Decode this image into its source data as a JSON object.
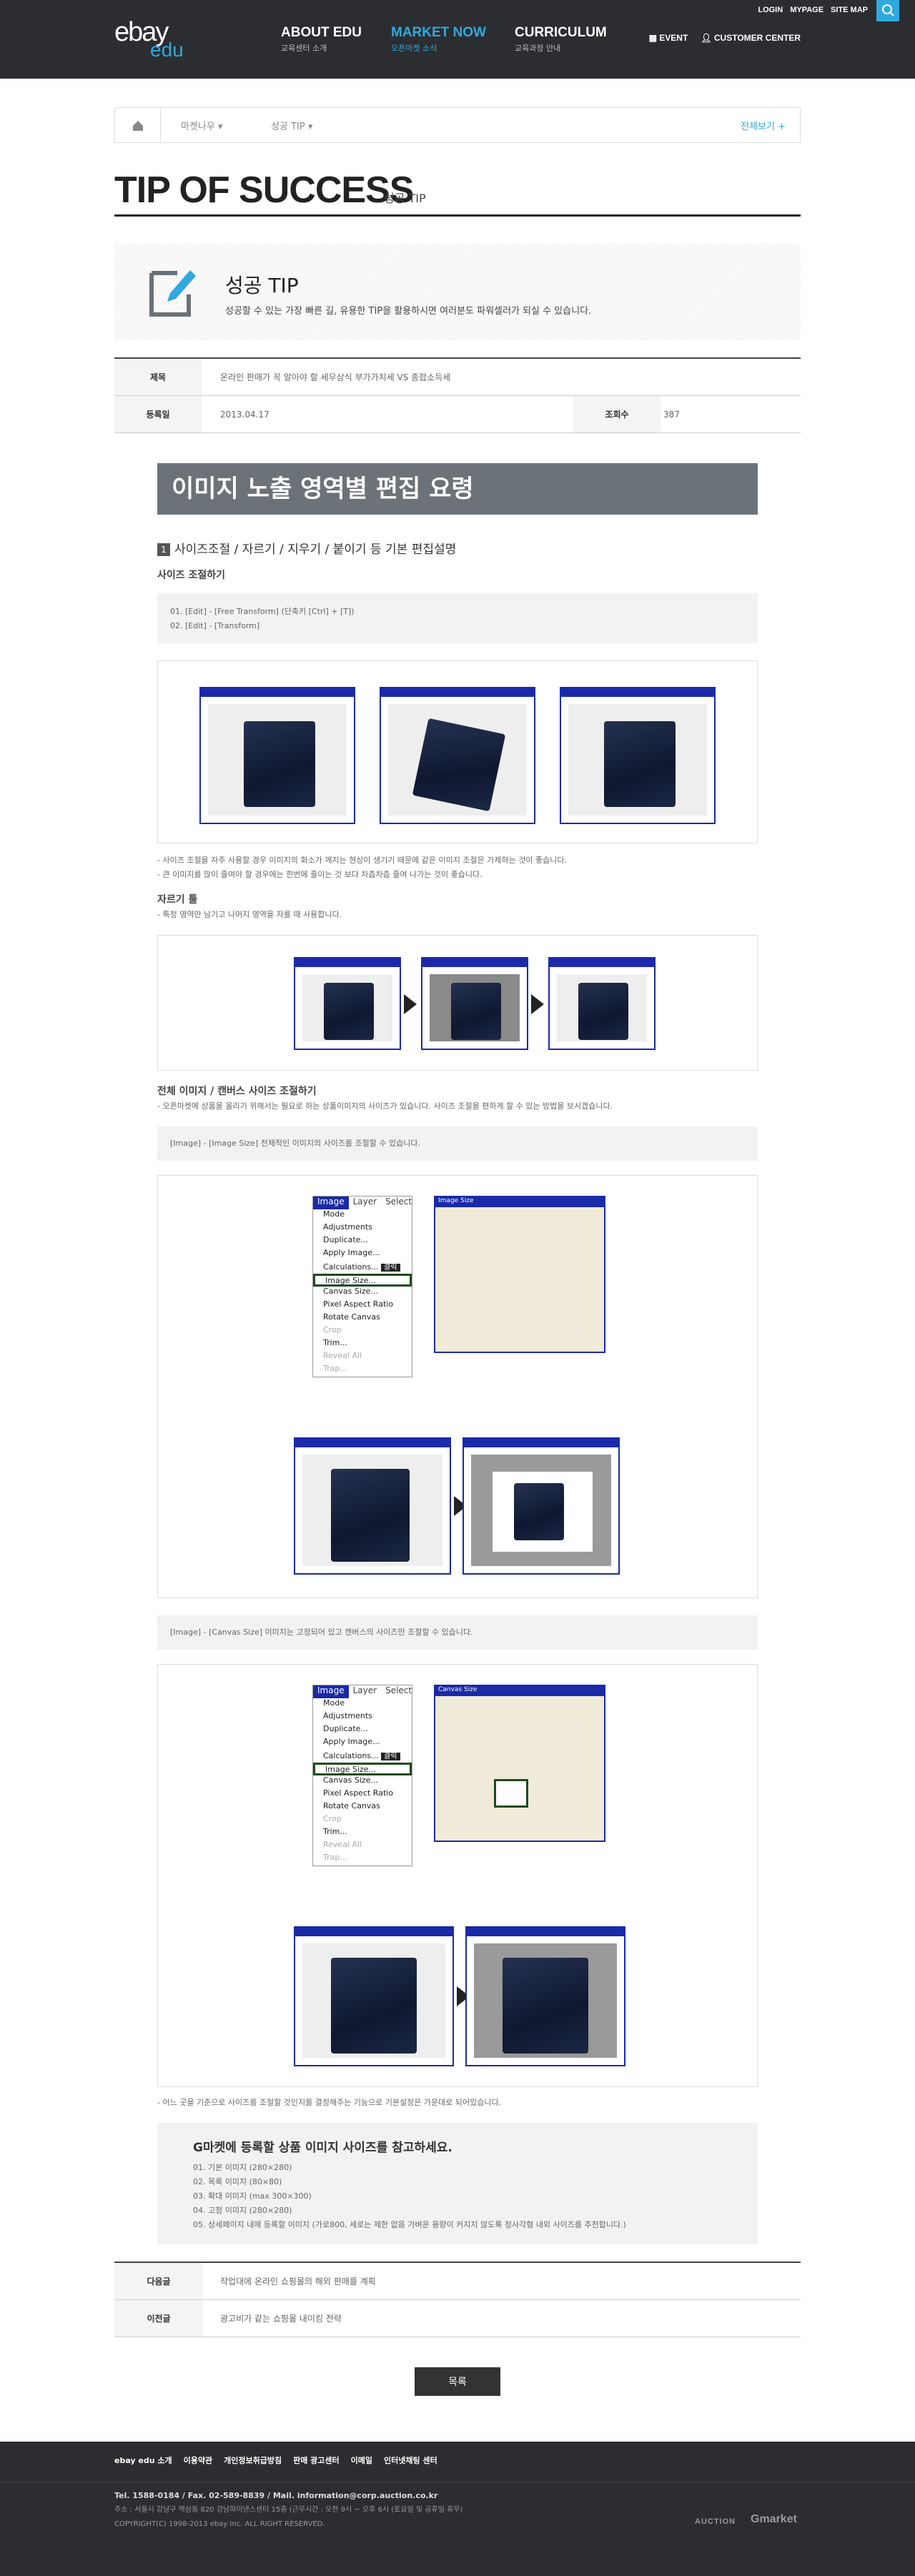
{
  "header": {
    "logo_top": "ebay",
    "logo_bottom": "edu",
    "nav": [
      {
        "title": "ABOUT EDU",
        "sub": "교육센터 소개"
      },
      {
        "title": "MARKET NOW",
        "sub": "오픈마켓 소식"
      },
      {
        "title": "CURRICULUM",
        "sub": "교육과정 안내"
      }
    ],
    "util": [
      "LOGIN",
      "MYPAGE",
      "SITE MAP"
    ],
    "event": "EVENT",
    "customer": "CUSTOMER CENTER"
  },
  "breadcrumb": {
    "c1": "마켓나우",
    "c2": "성공 TIP",
    "full": "전체보기"
  },
  "page": {
    "title": "TIP OF SUCCESS",
    "subtitle": "성공 TIP"
  },
  "tip": {
    "title": "성공 TIP",
    "desc": "성공할 수 있는 가장 빠른 길, 유용한 TIP을 활용하시면 여러분도 파워셀러가 되실 수 있습니다."
  },
  "info": {
    "subject_label": "제목",
    "subject": "온라인 판매가 꼭 알아야 할 세무상식 부가가치세 VS 종합소득세",
    "date_label": "등록일",
    "date": "2013.04.17",
    "views_label": "조회수",
    "views": "387"
  },
  "article": {
    "banner": "이미지 노출 영역별 편집 요령",
    "s1_num": "1",
    "s1_title": "사이즈조절 / 자르기 / 지우기 / 붙이기 등 기본 편집설명",
    "s1_sub": "사이즈 조절하기",
    "s1_steps": [
      "01. [Edit] - [Free Transform] (단축키 [Ctrl] + [T])",
      "02. [Edit] - [Transform]"
    ],
    "s1_notes": [
      "- 사이즈 조절을 자주 사용할 경우 이미지의 화소가 깨지는 현상이 생기기 때문에 같은 이미지 조절은 가제하는 것이 좋습니다.",
      "- 큰 이미지를 많이 줄여야 할 경우에는 한번에 줄이는 것 보다 차츰차츰 줄여 나가는 것이 좋습니다."
    ],
    "crop_title": "자르기 툴",
    "crop_note": "- 특정 영역만 남기고 나머지 영역을 자를 때 사용합니다.",
    "canvas_title": "전체 이미지 / 캔버스 사이즈 조절하기",
    "canvas_note": "- 오픈마켓에 상품을 올리기 위해서는 필요로 하는 상품이미지의 사이즈가 있습니다. 사이즈 조절을 편하게 할 수 있는 방법을 보시겠습니다.",
    "image_size_box": "[Image] - [Image Size] 전체적인 이미지의 사이즈를 조절할 수 있습니다.",
    "canvas_size_box": "[Image] - [Canvas Size] 이미지는 고정되어 있고 캔버스의 사이즈만 조절할 수 있습니다.",
    "canvas_note2": "- 어느 곳을 기준으로 사이즈를 조절할 것인지를 결정해주는 기능으로 기본설정은 가운데로 되어있습니다.",
    "menu_header": [
      "Image",
      "Layer",
      "Select"
    ],
    "menu_items": [
      "Mode",
      "Adjustments",
      "Duplicate...",
      "Apply Image...",
      "Calculations...",
      "Image Size...",
      "Canvas Size...",
      "Pixel Aspect Ratio",
      "Rotate Canvas",
      "Crop",
      "Trim...",
      "Reveal All",
      "Trap..."
    ],
    "menu_tip": "클릭",
    "dialog_image": "Image Size",
    "dialog_canvas": "Canvas Size",
    "guide_title": "G마켓에 등록할 상품 이미지 사이즈를 참고하세요.",
    "guide_list": [
      "01. 기본 이미지 (280×280)",
      "02. 목록 이미지 (80×80)",
      "03. 확대 이미지 (max 300×300)",
      "04. 고정 이미지 (280×280)",
      "05. 상세페이지 내에 등록할 이미지 (가로800, 세로는 제한 없음 가벼운 용량이 커지지 않도록 정사각형 내외 사이즈를 추천합니다.)"
    ]
  },
  "nav_rows": [
    {
      "label": "다음글",
      "value": "작업대에 온라인 쇼핑몰의 해외 판매를 계획"
    },
    {
      "label": "이전글",
      "value": "광고비가 같는 쇼핑몰 내이킹 전략"
    }
  ],
  "list_button": "목록",
  "footer": {
    "nav": [
      "ebay edu 소개",
      "이용약관",
      "개인정보취급방침",
      "판매 광고센터",
      "이메일",
      "인터넷채팅 센터"
    ],
    "tel": "Tel. 1588-0184  /  Fax. 02-589-8839  /  Mail. information@corp.auction.co.kr",
    "address": "주소 : 서울시 강남구 역삼동 820 강남파이낸스센터 15층 (근무시간 : 오전 9시 ~ 오후 6시 (토요일 및 공휴일 휴무)",
    "copyright": "COPYRIGHT(C) 1998-2013 ebay Inc. ALL RIGHT RESERVED.",
    "logos": [
      "AUCTION",
      "Gmarket"
    ]
  }
}
